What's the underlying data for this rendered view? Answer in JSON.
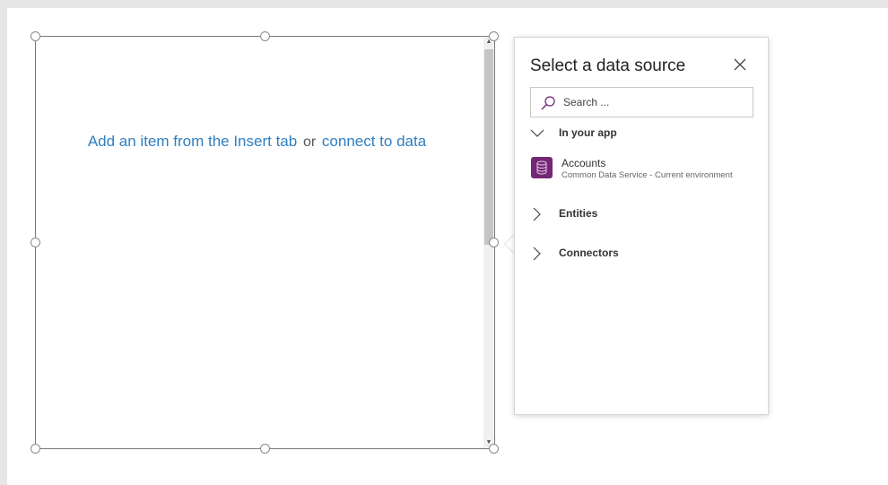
{
  "gallery": {
    "message_insert": "Add an item from the Insert tab",
    "message_or": "or",
    "message_connect": "connect to data"
  },
  "flyout": {
    "title": "Select a data source",
    "search_placeholder": "Search ...",
    "groups": [
      {
        "label": "In your app",
        "expanded": true
      },
      {
        "label": "Entities",
        "expanded": false
      },
      {
        "label": "Connectors",
        "expanded": false
      }
    ],
    "items": [
      {
        "name": "Accounts",
        "description": "Common Data Service - Current environment",
        "icon": "database-icon"
      }
    ]
  },
  "colors": {
    "link": "#2f7fc1",
    "db_icon_bg": "#742774"
  }
}
